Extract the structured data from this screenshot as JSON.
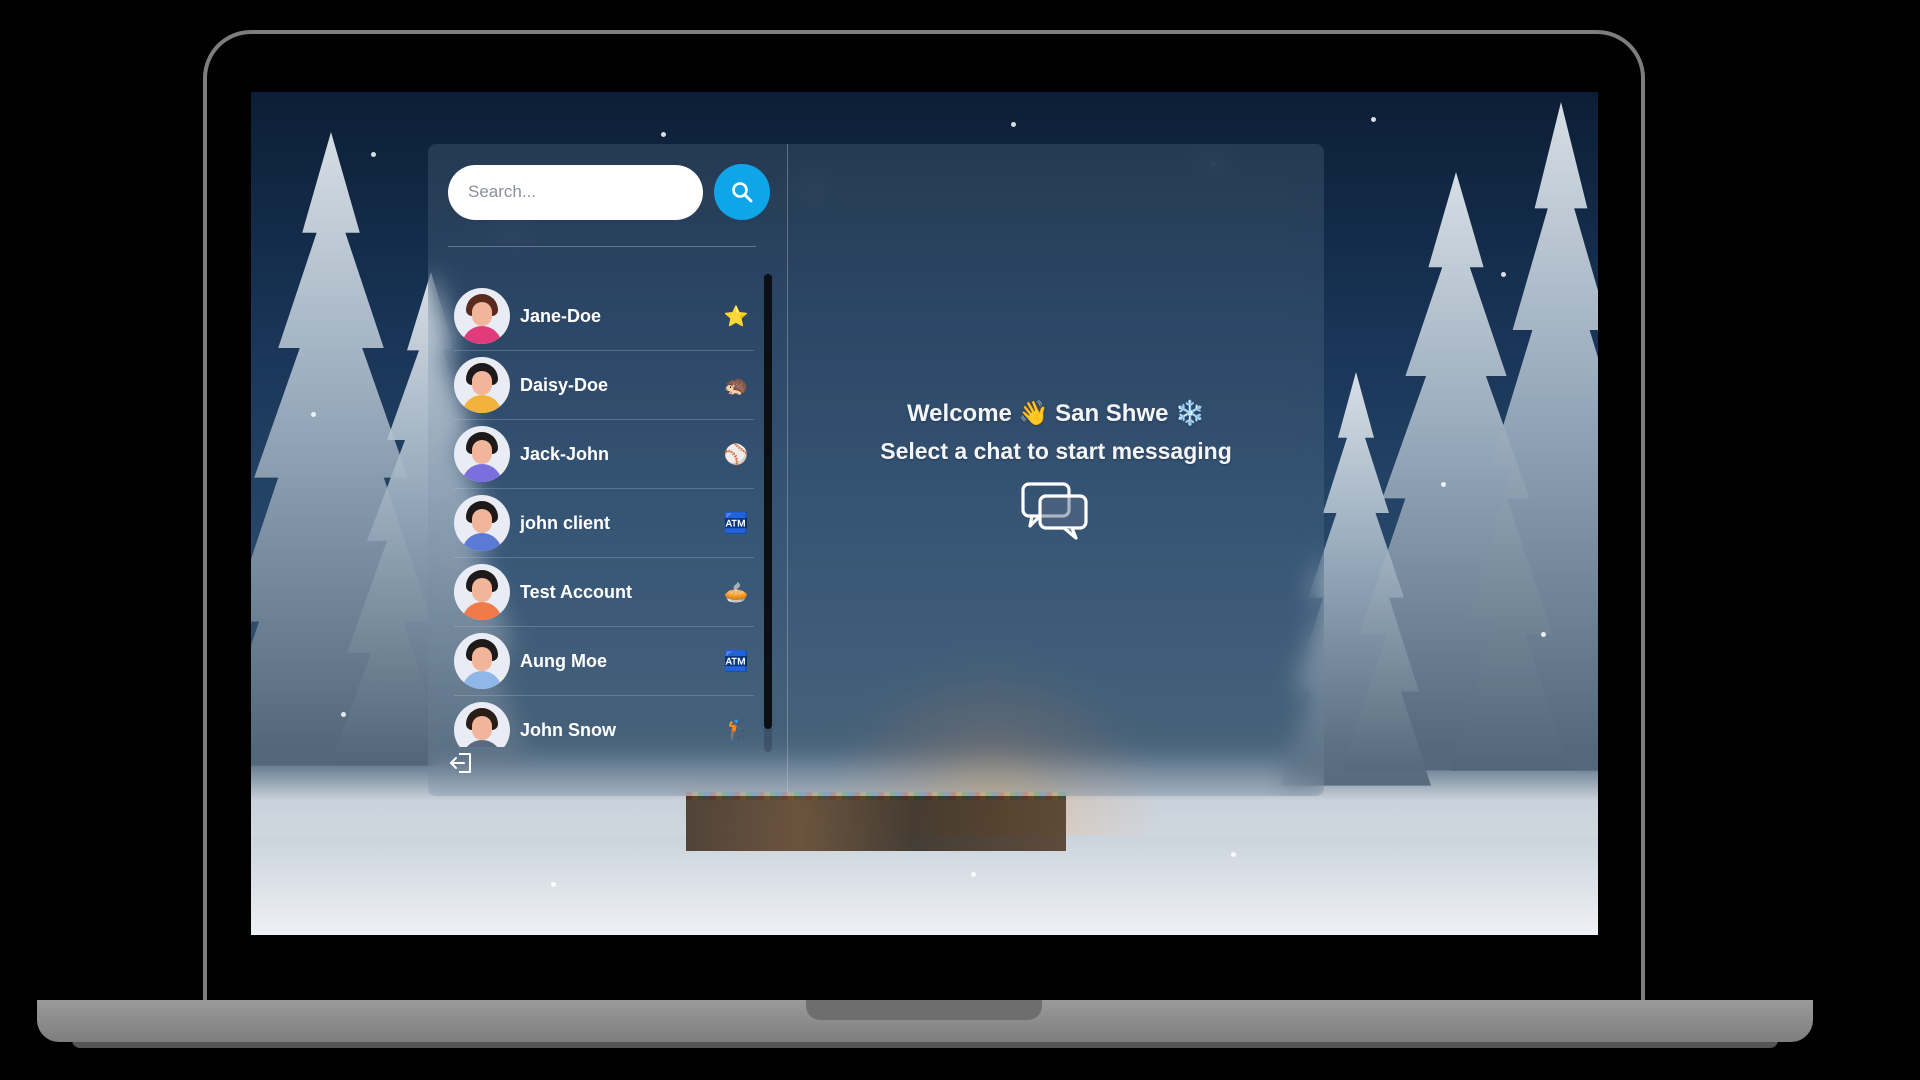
{
  "search": {
    "placeholder": "Search..."
  },
  "conversations": [
    {
      "name": "Jane-Doe",
      "emoji": "⭐",
      "hair": "#5a2a1e",
      "body": "#e23b7b"
    },
    {
      "name": "Daisy-Doe",
      "emoji": "🦔",
      "hair": "#1e1a1a",
      "body": "#f2b33d"
    },
    {
      "name": "Jack-John",
      "emoji": "⚾",
      "hair": "#1e1a1a",
      "body": "#7b6fe0"
    },
    {
      "name": "john client",
      "emoji": "🏧",
      "hair": "#1e1a1a",
      "body": "#5a7ad6"
    },
    {
      "name": "Test Account",
      "emoji": "🥧",
      "hair": "#1e1a1a",
      "body": "#f07a4a"
    },
    {
      "name": "Aung Moe",
      "emoji": "🏧",
      "hair": "#1e1a1a",
      "body": "#8fb7e8"
    },
    {
      "name": "John Snow",
      "emoji": "🏌",
      "hair": "#2a1c16",
      "body": "#5a6a80"
    }
  ],
  "main": {
    "welcome": "Welcome 👋 San Shwe ❄️",
    "subtext": "Select a chat to start messaging"
  },
  "colors": {
    "accent": "#0ea5e9"
  }
}
